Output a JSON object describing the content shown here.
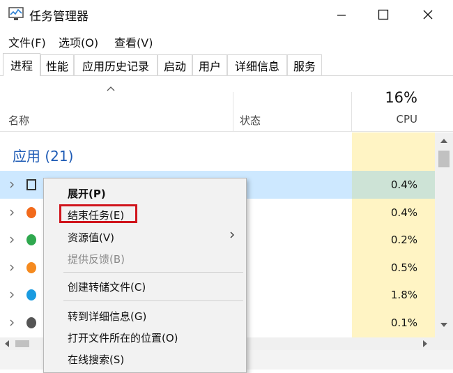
{
  "window": {
    "title": "任务管理器",
    "controls": {
      "minimize": "—",
      "maximize": "☐",
      "close": "✕"
    }
  },
  "menu": [
    "文件(F)",
    "选项(O)",
    "查看(V)"
  ],
  "tabs": [
    "进程",
    "性能",
    "应用历史记录",
    "启动",
    "用户",
    "详细信息",
    "服务"
  ],
  "active_tab": "进程",
  "columns": {
    "name": "名称",
    "status": "状态",
    "cpu_percent": "16%",
    "cpu": "CPU"
  },
  "group": {
    "title": "应用 (21)"
  },
  "rows": [
    {
      "cpu": "0.4%",
      "icon_color": "#333333",
      "selected": true
    },
    {
      "cpu": "0.4%",
      "icon_color": "#f26a1b"
    },
    {
      "cpu": "0.2%",
      "icon_color": "#2fa84f"
    },
    {
      "cpu": "0.5%",
      "icon_color": "#f58a1f"
    },
    {
      "cpu": "1.8%",
      "icon_color": "#1a9be0"
    },
    {
      "cpu": "0.1%",
      "icon_color": "#555555"
    }
  ],
  "context_menu": {
    "items": [
      {
        "label": "展开(P)",
        "style": "bold"
      },
      {
        "label": "结束任务(E)",
        "style": "highlighted"
      },
      {
        "label": "资源值(V)",
        "submenu": true
      },
      {
        "label": "提供反馈(B)",
        "style": "disabled"
      },
      {
        "label": "创建转储文件(C)"
      },
      {
        "label": "转到详细信息(G)"
      },
      {
        "label": "打开文件所在的位置(O)"
      },
      {
        "label": "在线搜索(S)"
      }
    ],
    "highlight_color": "#d0141c"
  },
  "colors": {
    "group_title": "#1e5bb5",
    "cpu_column": "#fff4c4",
    "selected_row": "#cde8ff"
  }
}
